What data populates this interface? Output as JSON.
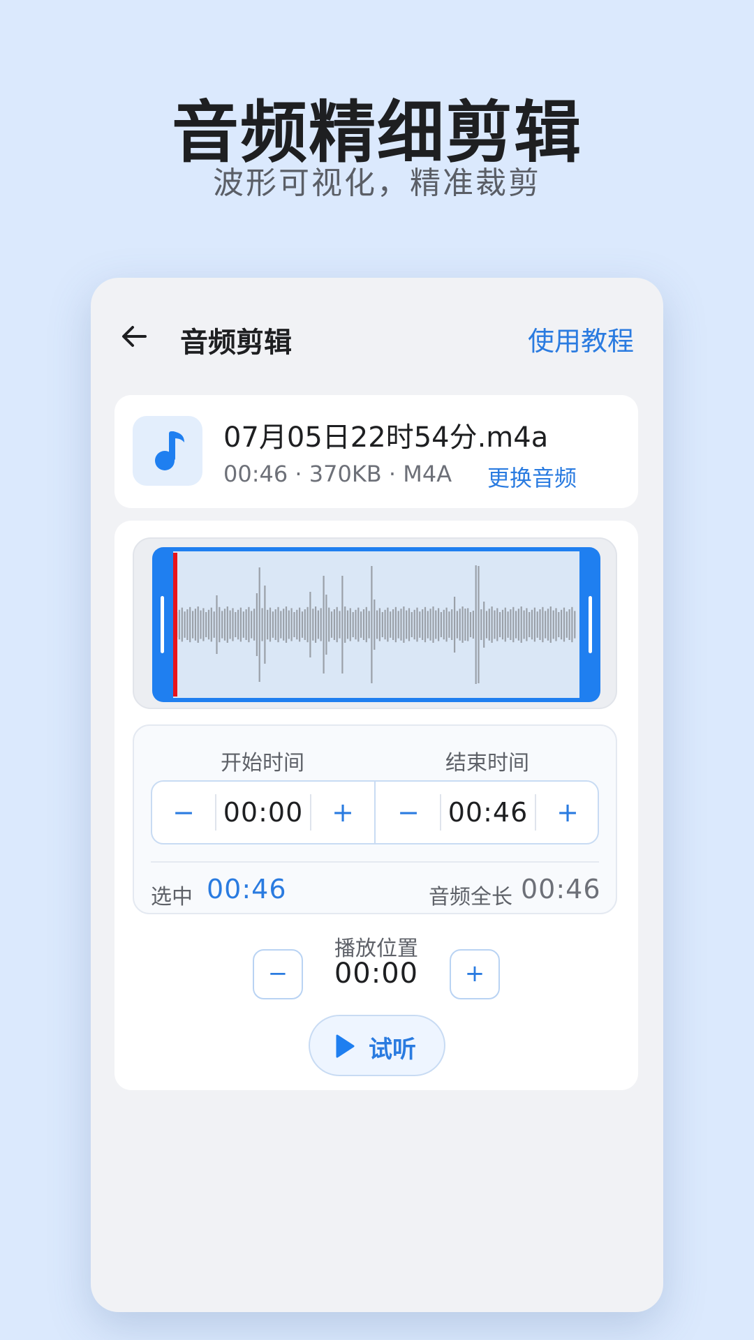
{
  "hero": {
    "title": "音频精细剪辑",
    "subtitle": "波形可视化，精准裁剪"
  },
  "appbar": {
    "back_icon": "arrow-left-icon",
    "title": "音频剪辑",
    "tutorial": "使用教程"
  },
  "file": {
    "icon": "music-note-icon",
    "name": "07月05日22时54分.m4a",
    "meta": "00:46 · 370KB · M4A",
    "replace": "更换音频"
  },
  "waveform": {
    "playhead_fraction": 0.0,
    "selection_start_fraction": 0.0,
    "selection_end_fraction": 1.0
  },
  "time_range": {
    "start_label": "开始时间",
    "end_label": "结束时间",
    "start_value": "00:00",
    "end_value": "00:46",
    "minus": "−",
    "plus": "+",
    "selected_label": "选中",
    "selected_value": "00:46",
    "total_label": "音频全长",
    "total_value": "00:46"
  },
  "playback": {
    "label": "播放位置",
    "value": "00:00",
    "minus": "−",
    "plus": "+",
    "preview_label": "试听",
    "preview_icon": "play-icon"
  },
  "colors": {
    "accent": "#2a7be0",
    "selection": "#1f7ff0",
    "playhead": "#e8141b",
    "background": "#dbe9fd"
  }
}
